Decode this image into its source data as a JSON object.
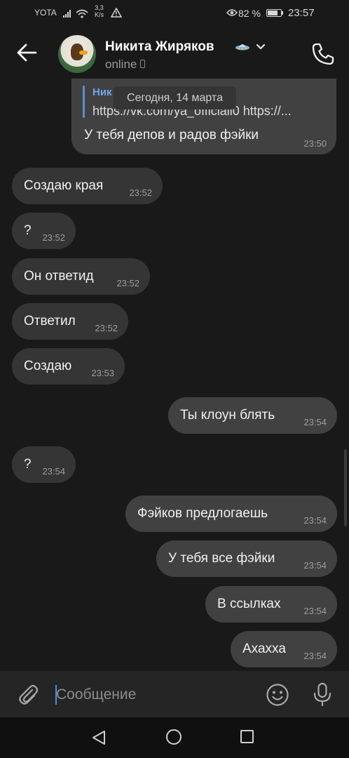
{
  "status_bar": {
    "carrier": "YOTA",
    "speed_value": "3,3",
    "speed_unit": "K/s",
    "battery": "82 %",
    "battery_level": 0.82,
    "time": "23:57"
  },
  "header": {
    "name": "Никита Жиряков",
    "status": "online"
  },
  "reply_message": {
    "quote_author": "Ник",
    "quote_text": "https://vk.com/ya_officiall0 https://...",
    "text": "У тебя депов и радов фэйки",
    "time": "23:50"
  },
  "date_divider": "Сегодня, 14 марта",
  "messages": [
    {
      "text": "Создаю края",
      "time": "23:52",
      "direction": "in"
    },
    {
      "text": "?",
      "time": "23:52",
      "direction": "in"
    },
    {
      "text": "Он ответид",
      "time": "23:52",
      "direction": "in"
    },
    {
      "text": "Ответил",
      "time": "23:52",
      "direction": "in"
    },
    {
      "text": "Создаю",
      "time": "23:53",
      "direction": "in"
    },
    {
      "text": "Ты клоун блять",
      "time": "23:54",
      "direction": "out"
    },
    {
      "text": "?",
      "time": "23:54",
      "direction": "in"
    },
    {
      "text": "Фэйков предлогаешь",
      "time": "23:54",
      "direction": "out"
    },
    {
      "text": "У тебя все фэйки",
      "time": "23:54",
      "direction": "out"
    },
    {
      "text": "В ссылках",
      "time": "23:54",
      "direction": "out"
    },
    {
      "text": "Ахахха",
      "time": "23:54",
      "direction": "out"
    }
  ],
  "composer": {
    "placeholder": "Сообщение"
  },
  "icons": {
    "back": "arrow-left-icon",
    "call": "phone-icon",
    "attach": "paperclip-icon",
    "emoji": "smile-icon",
    "voice": "microphone-icon",
    "device": "mobile-device-icon",
    "badge": "ufo-icon"
  },
  "colors": {
    "background": "#19191a",
    "incoming_bubble": "#353535",
    "outgoing_bubble": "#414141",
    "accent": "#73a6e8"
  }
}
